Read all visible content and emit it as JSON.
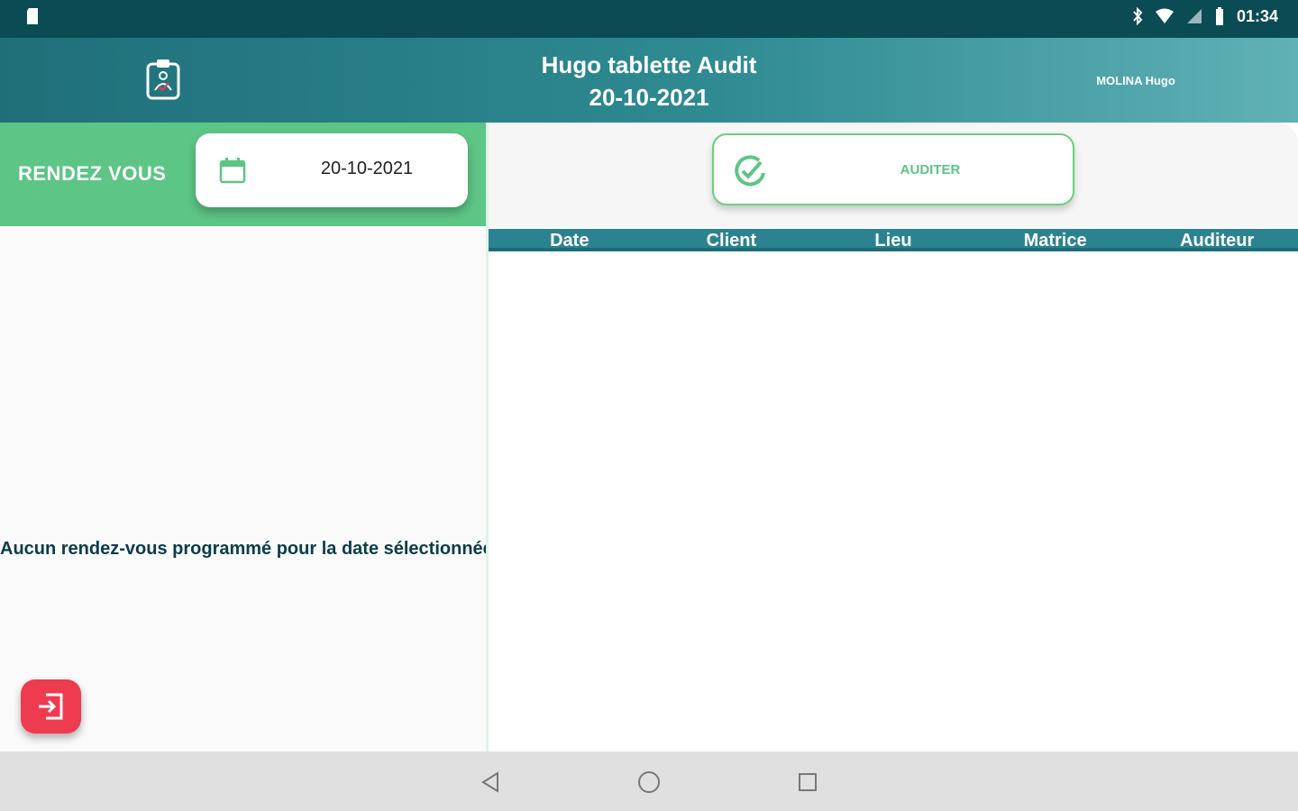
{
  "status_bar": {
    "time": "01:34"
  },
  "header": {
    "title": "Hugo tablette Audit",
    "date": "20-10-2021",
    "user": "MOLINA Hugo"
  },
  "left": {
    "section_label": "RENDEZ VOUS",
    "selected_date": "20-10-2021",
    "empty_message": "Aucun rendez-vous programmé pour la date sélectionnée"
  },
  "right": {
    "audit_button_label": "AUDITER",
    "table_headers": [
      "Date",
      "Client",
      "Lieu",
      "Matrice",
      "Auditeur"
    ]
  },
  "colors": {
    "header_dark": "#1f6f79",
    "accent_green": "#5dc585",
    "danger_red": "#ef3b4f",
    "table_header": "#2c8390"
  }
}
